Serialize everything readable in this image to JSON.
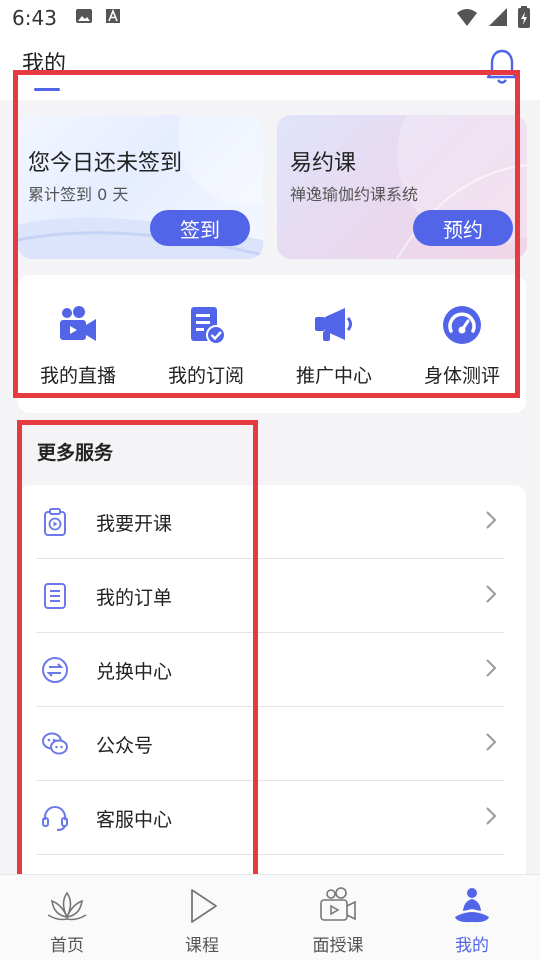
{
  "status_bar": {
    "time": "6:43"
  },
  "header": {
    "title": "我的"
  },
  "cards": {
    "signin": {
      "title": "您今日还未签到",
      "subtitle": "累计签到 0 天",
      "button": "签到"
    },
    "booking": {
      "title": "易约课",
      "subtitle": "禅逸瑜伽约课系统",
      "button": "预约"
    }
  },
  "quick_actions": [
    {
      "label": "我的直播",
      "icon": "video-camera-icon"
    },
    {
      "label": "我的订阅",
      "icon": "subscription-icon"
    },
    {
      "label": "推广中心",
      "icon": "megaphone-icon"
    },
    {
      "label": "身体测评",
      "icon": "gauge-icon"
    }
  ],
  "services": {
    "title": "更多服务",
    "items": [
      {
        "label": "我要开课",
        "icon": "clipboard-play-icon"
      },
      {
        "label": "我的订单",
        "icon": "order-list-icon"
      },
      {
        "label": "兑换中心",
        "icon": "exchange-icon"
      },
      {
        "label": "公众号",
        "icon": "wechat-icon"
      },
      {
        "label": "客服中心",
        "icon": "headset-icon"
      }
    ]
  },
  "bottom_nav": [
    {
      "label": "首页",
      "icon": "lotus-icon"
    },
    {
      "label": "课程",
      "icon": "play-icon"
    },
    {
      "label": "面授课",
      "icon": "video-class-icon"
    },
    {
      "label": "我的",
      "icon": "meditation-person-icon",
      "active": true
    }
  ],
  "colors": {
    "accent": "#5264e8",
    "annotation": "#e53a3f"
  }
}
